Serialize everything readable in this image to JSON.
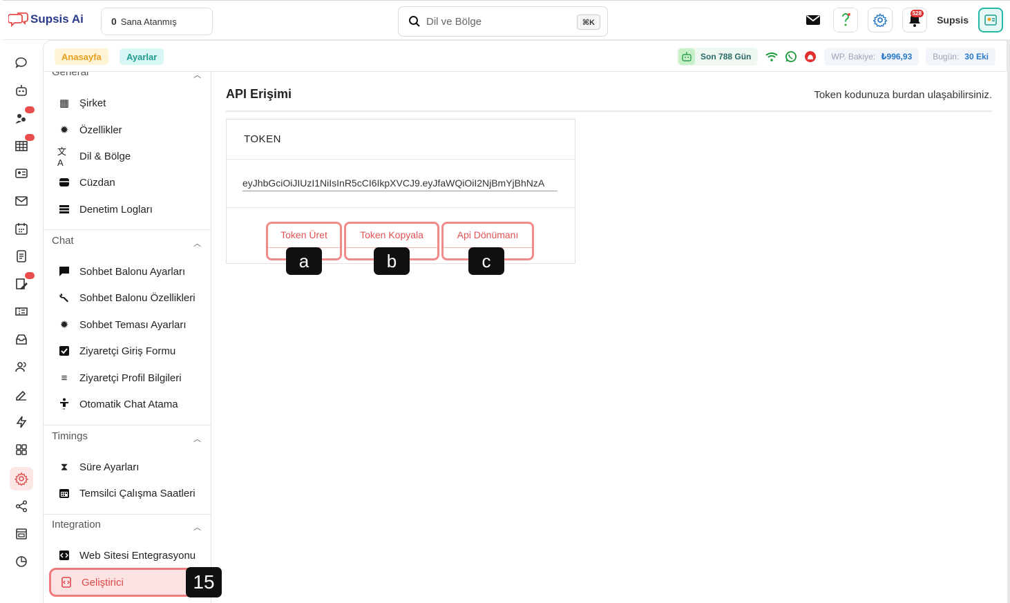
{
  "app": {
    "name": "Supsis Ai"
  },
  "topbar": {
    "assigned_count": "0",
    "assigned_label": "Sana Atanmış",
    "search_placeholder": "Dil ve Bölge",
    "search_shortcut": "⌘K",
    "notification_count": "528",
    "username": "Supsis"
  },
  "subheader": {
    "crumbs": [
      "Anasayfa",
      "Ayarlar"
    ],
    "days_left": "Son 788 Gün",
    "wp_balance_label": "WP. Bakiye:",
    "wp_balance_value": "₺996,93",
    "today_label": "Bugün:",
    "today_value": "30 Eki"
  },
  "settings_nav": {
    "general_title": "General",
    "general_items": [
      "Şirket",
      "Özellikler",
      "Dil & Bölge",
      "Cüzdan",
      "Denetim Logları"
    ],
    "chat_title": "Chat",
    "chat_items": [
      "Sohbet Balonu Ayarları",
      "Sohbet Balonu Özellikleri",
      "Sohbet Teması Ayarları",
      "Ziyaretçi Giriş Formu",
      "Ziyaretçi Profil Bilgileri",
      "Otomatik Chat Atama"
    ],
    "timings_title": "Timings",
    "timings_items": [
      "Süre Ayarları",
      "Temsilci Çalışma Saatleri"
    ],
    "integration_title": "Integration",
    "integration_items": [
      "Web Sitesi Entegrasyonu",
      "Geliştirici"
    ]
  },
  "main": {
    "title": "API Erişimi",
    "subtitle": "Token kodunuza burdan ulaşabilirsiniz.",
    "card_title": "TOKEN",
    "token_value": "eyJhbGciOiJIUzI1NiIsInR5cCI6IkpXVCJ9.eyJfaWQiOiI2NjBmYjBhNzA",
    "buttons": {
      "generate": "Token Üret",
      "copy": "Token Kopyala",
      "docs": "Api Dönümanı"
    }
  },
  "annotations": {
    "a": "a",
    "b": "b",
    "c": "c",
    "step": "15"
  },
  "colors": {
    "brand": "#2a3a8a",
    "accent_red": "#e05050",
    "teal": "#1e9c90",
    "highlight_border": "#f07a7a"
  }
}
